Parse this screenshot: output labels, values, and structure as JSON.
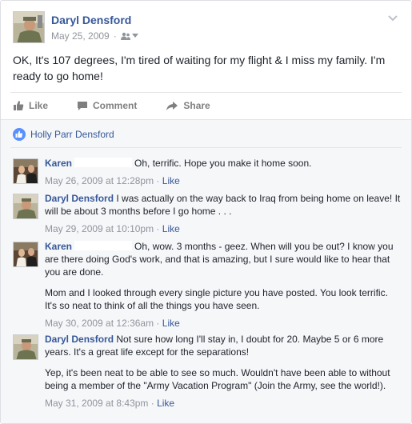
{
  "post": {
    "author": "Daryl Densford",
    "date": "May 25, 2009",
    "privacy_icon": "friends-icon",
    "text": "OK, It's 107 degrees, I'm tired of waiting for my flight & I miss my family. I'm ready to go home!"
  },
  "actions": {
    "like": "Like",
    "comment": "Comment",
    "share": "Share"
  },
  "likes": {
    "names": "Holly Parr Densford"
  },
  "comments": [
    {
      "author": "Karen",
      "paragraphs": [
        "Oh, terrific. Hope you make it home soon."
      ],
      "timestamp": "May 26, 2009 at 12:28pm",
      "sep": " · ",
      "like": "Like"
    },
    {
      "author": "Daryl Densford",
      "paragraphs": [
        "I was actually on the way back to Iraq from being home on leave! It will be about 3 months before I go home . . ."
      ],
      "timestamp": "May 29, 2009 at 10:10pm",
      "sep": " · ",
      "like": "Like"
    },
    {
      "author": "Karen",
      "paragraphs": [
        "Oh, wow. 3 months - geez. When will you be out? I know you are there doing God's work, and that is amazing, but I sure would like to hear that you are done.",
        "Mom and I looked through every single picture you have posted. You look terrific. It's so neat to think of all the things you have seen."
      ],
      "timestamp": "May 30, 2009 at 12:36am",
      "sep": " · ",
      "like": "Like"
    },
    {
      "author": "Daryl Densford",
      "paragraphs": [
        "Not sure how long I'll stay in, I doubt for 20. Maybe 5 or 6 more years. It's a great life except for the separations!",
        "Yep, it's been neat to be able to see so much. Wouldn't have been able to without being a member of the \"Army Vacation Program\" (Join the Army, see the world!)."
      ],
      "timestamp": "May 31, 2009 at 8:43pm",
      "sep": " · ",
      "like": "Like"
    }
  ],
  "colors": {
    "link": "#365899",
    "meta": "#90949c",
    "text": "#1d2129",
    "comment_bg": "#f6f7f9"
  }
}
